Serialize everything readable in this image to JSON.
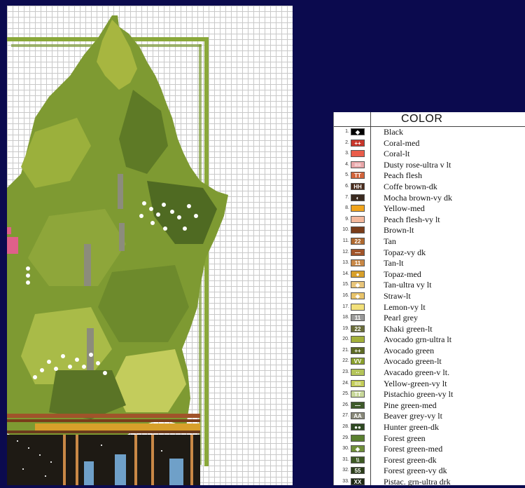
{
  "key": {
    "title": "COLOR",
    "rows": [
      {
        "num": "1.",
        "symbol": "◆",
        "color": "#000000",
        "name": "Black"
      },
      {
        "num": "2.",
        "symbol": "++",
        "color": "#c8362b",
        "name": "Coral-med"
      },
      {
        "num": "3.",
        "symbol": "",
        "color": "#e95c4a",
        "name": "Coral-lt"
      },
      {
        "num": "4.",
        "symbol": "==",
        "color": "#e9a6a9",
        "name": "Dusty rose-ultra v lt"
      },
      {
        "num": "5.",
        "symbol": "TT",
        "color": "#d2633a",
        "name": "Peach flesh"
      },
      {
        "num": "6.",
        "symbol": "HH",
        "color": "#4a2c1c",
        "name": "Coffe brown-dk"
      },
      {
        "num": "7.",
        "symbol": "◐",
        "color": "#3a2a20",
        "name": "Mocha brown-vy dk"
      },
      {
        "num": "8.",
        "symbol": "",
        "color": "#f0a41c",
        "name": "Yellow-med"
      },
      {
        "num": "9.",
        "symbol": "",
        "color": "#f3b89c",
        "name": "Peach flesh-vy lt"
      },
      {
        "num": "10.",
        "symbol": "",
        "color": "#7a3d1a",
        "name": "Brown-lt"
      },
      {
        "num": "11.",
        "symbol": "22",
        "color": "#b0692e",
        "name": "Tan"
      },
      {
        "num": "12.",
        "symbol": "—",
        "color": "#a0542a",
        "name": "Topaz-vy dk"
      },
      {
        "num": "13.",
        "symbol": "11",
        "color": "#c98846",
        "name": "Tan-lt"
      },
      {
        "num": "14.",
        "symbol": "●",
        "color": "#d8a02a",
        "name": "Topaz-med"
      },
      {
        "num": "15.",
        "symbol": "◆",
        "color": "#e8c57a",
        "name": "Tan-ultra vy lt"
      },
      {
        "num": "16.",
        "symbol": "◈",
        "color": "#e8c36a",
        "name": "Straw-lt"
      },
      {
        "num": "17.",
        "symbol": "",
        "color": "#f2e07a",
        "name": "Lemon-vy lt"
      },
      {
        "num": "18.",
        "symbol": "11",
        "color": "#9a9a9a",
        "name": "Pearl grey"
      },
      {
        "num": "19.",
        "symbol": "22",
        "color": "#6b6e3a",
        "name": "Khaki green-lt"
      },
      {
        "num": "20.",
        "symbol": "",
        "color": "#a3b03a",
        "name": "Avocado grn-ultra lt"
      },
      {
        "num": "21.",
        "symbol": "++",
        "color": "#5d6a24",
        "name": "Avocado green"
      },
      {
        "num": "22.",
        "symbol": "VV",
        "color": "#8aa02c",
        "name": "Avocado green-lt"
      },
      {
        "num": "23.",
        "symbol": "··",
        "color": "#b4c45a",
        "name": "Avacado green-v lt."
      },
      {
        "num": "24.",
        "symbol": "==",
        "color": "#c3cc58",
        "name": "Yellow-green-vy lt"
      },
      {
        "num": "25.",
        "symbol": "TT",
        "color": "#c8d89a",
        "name": "Pistachio green-vy lt"
      },
      {
        "num": "26.",
        "symbol": "—",
        "color": "#3e5a2a",
        "name": "Pine green-med"
      },
      {
        "num": "27.",
        "symbol": "AA",
        "color": "#8a8a7a",
        "name": "Beaver grey-vy lt"
      },
      {
        "num": "28.",
        "symbol": "●●",
        "color": "#2f4a22",
        "name": "Hunter green-dk"
      },
      {
        "num": "29.",
        "symbol": "",
        "color": "#5a8030",
        "name": "Forest green"
      },
      {
        "num": "30.",
        "symbol": "◈",
        "color": "#6f8f3a",
        "name": "Forest green-med"
      },
      {
        "num": "31.",
        "symbol": "\\\\",
        "color": "#3e5a24",
        "name": "Forest green-dk"
      },
      {
        "num": "32.",
        "symbol": "55",
        "color": "#2c3e1a",
        "name": "Forest green-vy dk"
      },
      {
        "num": "33.",
        "symbol": "XX",
        "color": "#1e2a14",
        "name": "Pistac. grn-ultra drk"
      }
    ]
  }
}
